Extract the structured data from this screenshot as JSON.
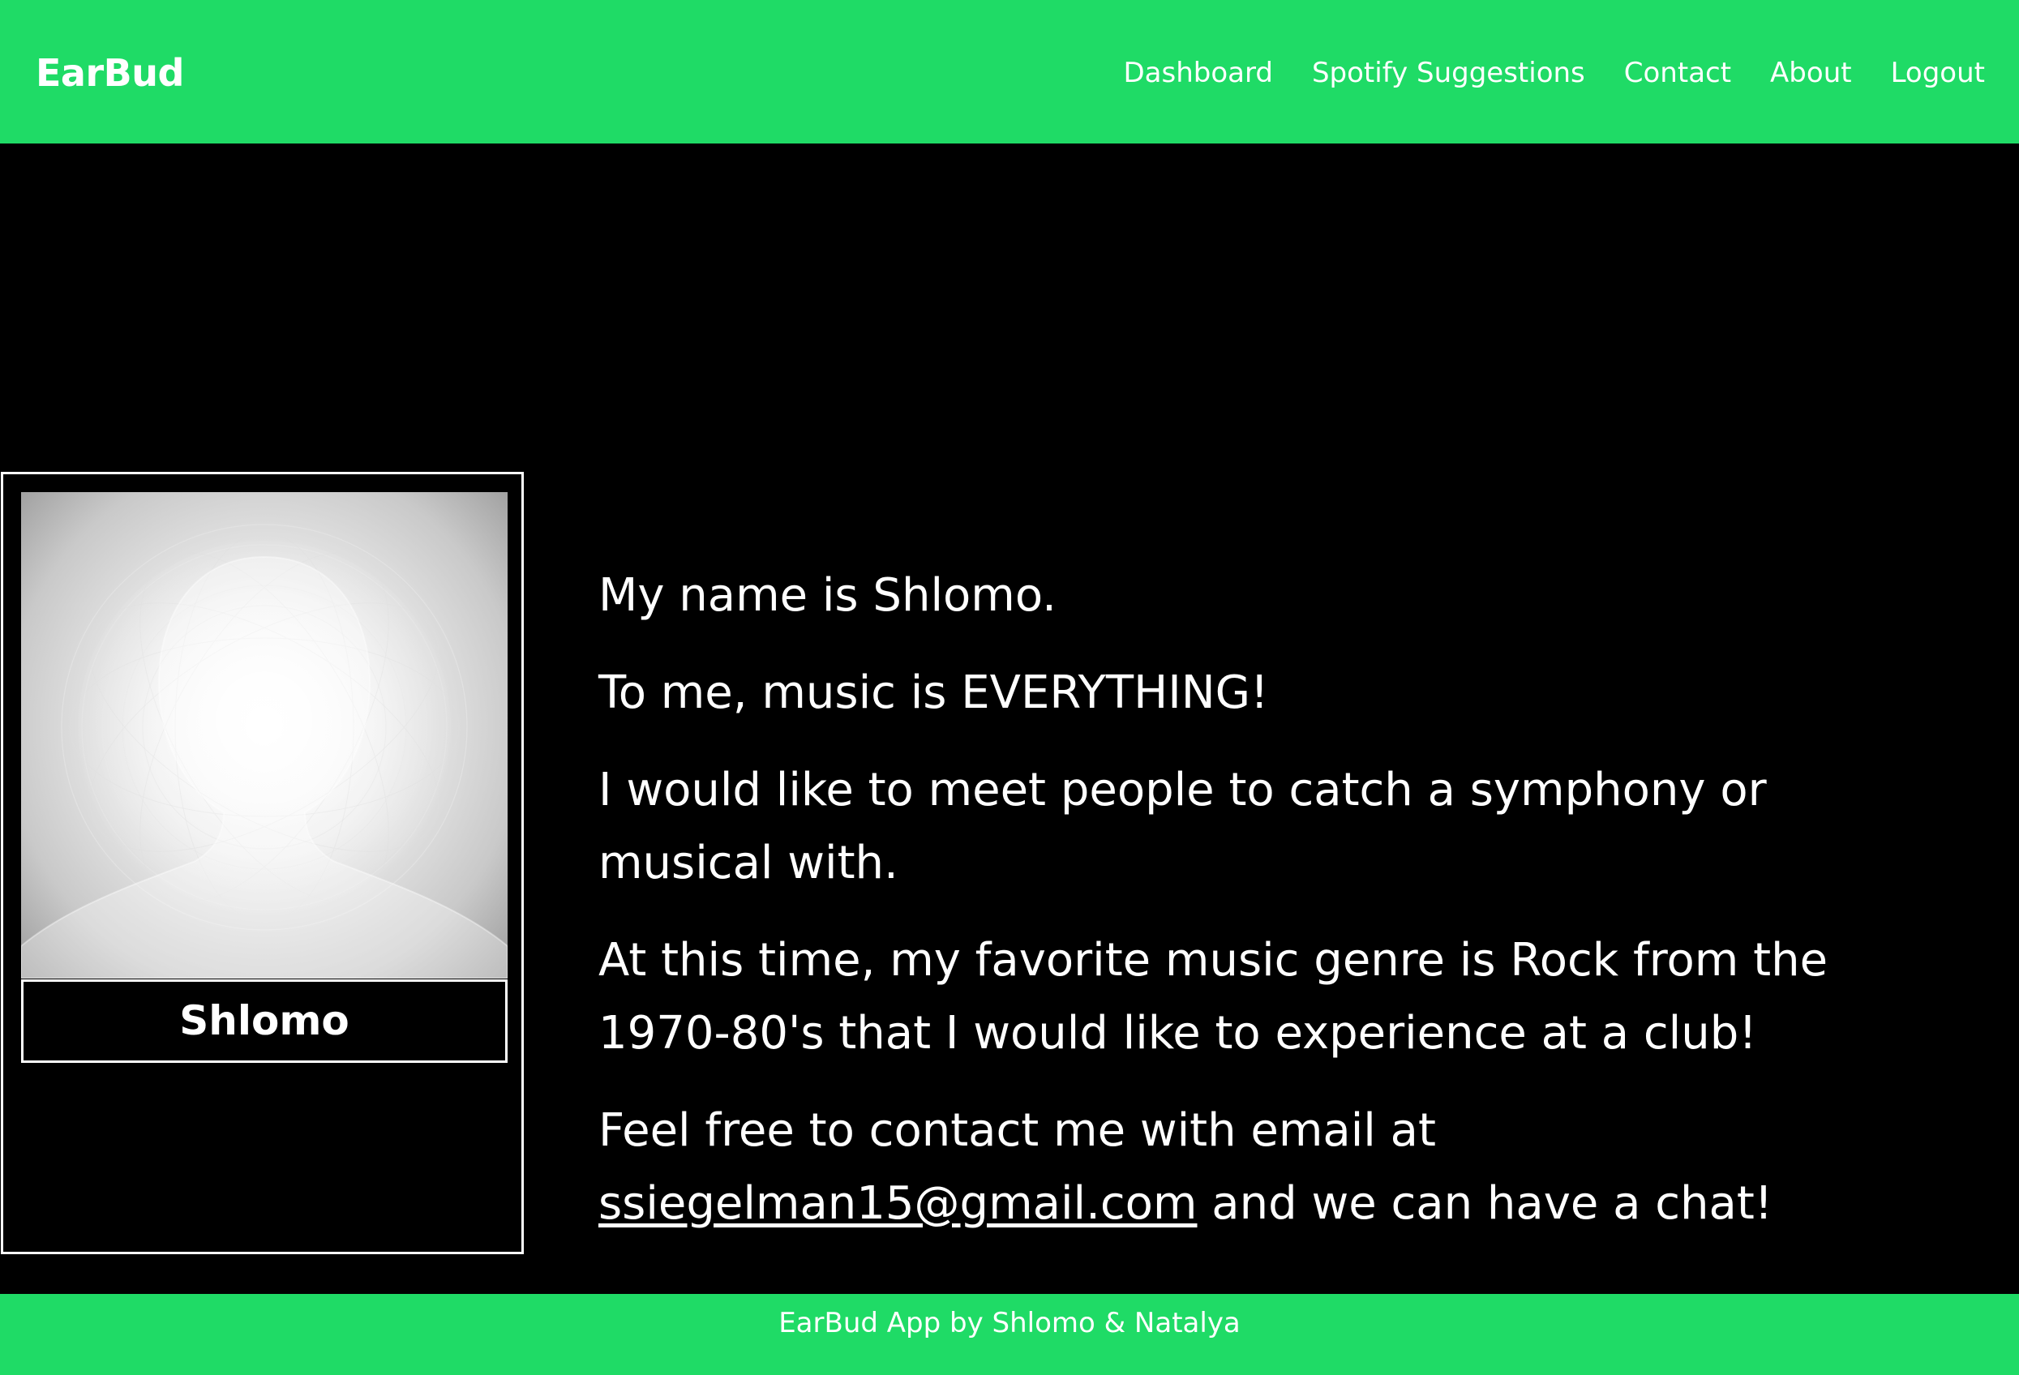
{
  "app": {
    "brand": "EarBud"
  },
  "nav": {
    "items": [
      {
        "label": "Dashboard"
      },
      {
        "label": "Spotify Suggestions"
      },
      {
        "label": "Contact"
      },
      {
        "label": "About"
      },
      {
        "label": "Logout"
      }
    ]
  },
  "profile": {
    "name": "Shlomo",
    "avatar_icon": "default-avatar-silhouette-icon"
  },
  "bio": {
    "line1": "My name is Shlomo.",
    "line2": "To me, music is EVERYTHING!",
    "line3": "I would like to meet people to catch a symphony or musical with.",
    "line4": "At this time, my favorite music genre is Rock from the 1970-80's that I would like to experience at a club!",
    "line5_prefix": "Feel free to contact me with email at",
    "email": "ssiegelman15@gmail.com",
    "line5_suffix": "and we can have a chat!"
  },
  "footer": {
    "text": "EarBud App by Shlomo & Natalya"
  },
  "colors": {
    "brand_green": "#1fdb66",
    "background": "#000000",
    "text": "#ffffff"
  }
}
